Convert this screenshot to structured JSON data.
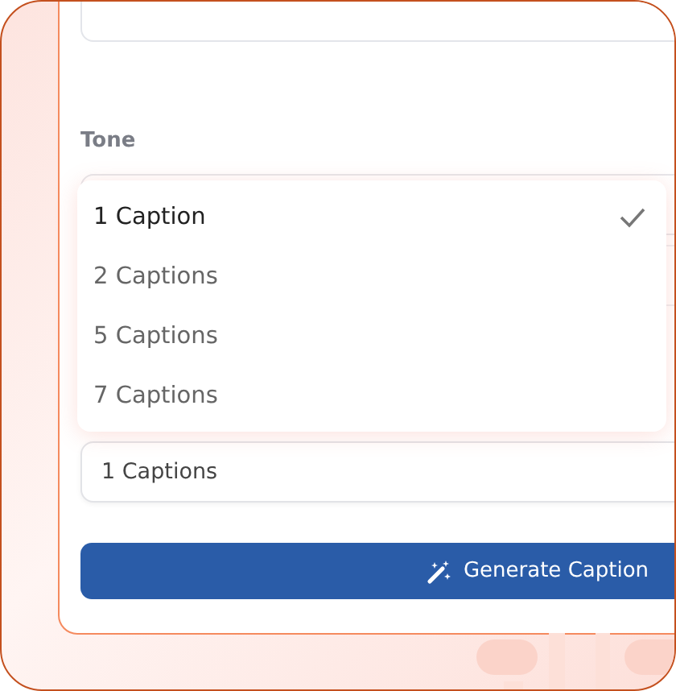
{
  "tone": {
    "label": "Tone"
  },
  "dropdown": {
    "options": [
      {
        "label": "1 Caption",
        "selected": true
      },
      {
        "label": "2 Captions",
        "selected": false
      },
      {
        "label": "5 Captions",
        "selected": false
      },
      {
        "label": "7 Captions",
        "selected": false
      }
    ]
  },
  "caption_count_field": {
    "value": "1 Captions"
  },
  "generate_button": {
    "label": "Generate Caption"
  }
}
